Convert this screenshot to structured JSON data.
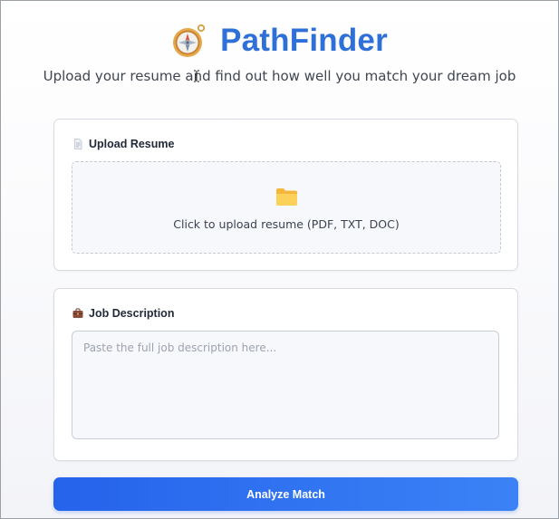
{
  "app": {
    "title": "PathFinder",
    "tagline": "Upload your resume and find out how well you match your dream job",
    "logo_icon": "compass-icon",
    "brand_color": "#2f6fd8"
  },
  "upload_section": {
    "title": "Upload Resume",
    "title_icon": "document-icon",
    "dropzone_icon": "folder-icon",
    "dropzone_label": "Click to upload resume (PDF, TXT, DOC)"
  },
  "job_section": {
    "title": "Job Description",
    "title_icon": "briefcase-icon",
    "textarea_value": "",
    "textarea_placeholder": "Paste the full job description here..."
  },
  "actions": {
    "analyze_label": "Analyze Match",
    "button_color": "#2563eb"
  },
  "cursor": {
    "icon": "text-cursor-icon"
  }
}
